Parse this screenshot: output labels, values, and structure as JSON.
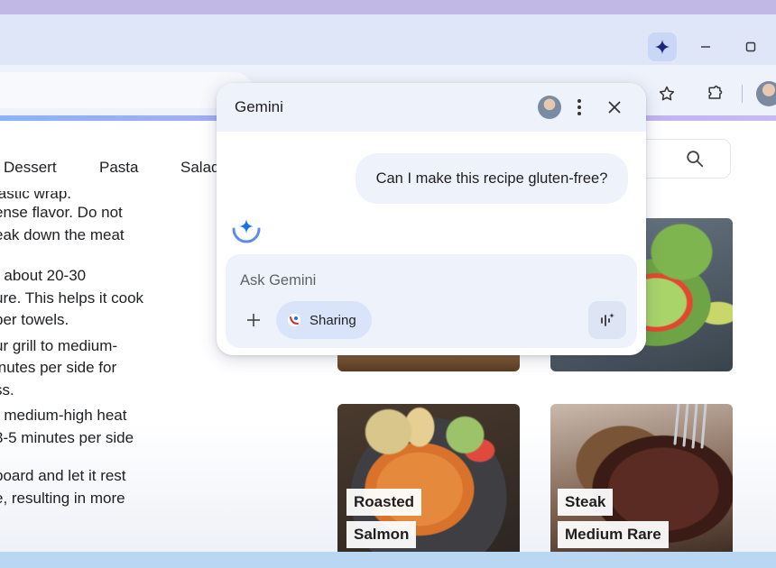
{
  "page_nav": {
    "items": [
      "Dessert",
      "Pasta",
      "Salad"
    ]
  },
  "recipe": {
    "lines": [
      "lastic wrap.",
      "ense flavor. Do not",
      "eak down the meat",
      "",
      "r about 20-30",
      "ure. This helps it cook",
      "per towels.",
      "ur grill to medium-",
      "inutes per side for",
      "ss.",
      "r medium-high heat",
      "3-5 minutes per side",
      "",
      "board and let it rest",
      "e, resulting in more"
    ]
  },
  "cards": {
    "salmon": {
      "line1": "Roasted",
      "line2": "Salmon"
    },
    "steak": {
      "line1": "Steak",
      "line2": "Medium Rare"
    }
  },
  "gemini_panel": {
    "title": "Gemini",
    "user_message": "Can I make this recipe gluten-free?",
    "input_placeholder": "Ask Gemini",
    "sharing_label": "Sharing"
  },
  "colors": {
    "accent": "#1a73e8",
    "panel_surface": "#eef2fb",
    "chip": "#d9e4fb"
  },
  "icons": {
    "toolbar": [
      "gemini-icon",
      "minimize-icon",
      "maximize-icon",
      "star-icon",
      "extension-icon",
      "profile-avatar"
    ],
    "panel": [
      "avatar",
      "more-vert-icon",
      "close-icon",
      "gemini-spark-icon",
      "add-icon",
      "tab-sharing-icon",
      "voice-waveform-icon"
    ]
  }
}
